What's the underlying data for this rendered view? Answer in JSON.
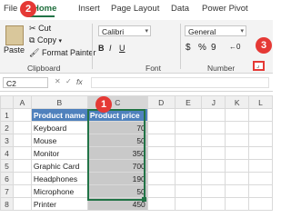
{
  "ribbon_tabs": [
    "File",
    "Home",
    "Insert",
    "Page Layout",
    "Data",
    "Power Pivot"
  ],
  "clipboard": {
    "paste": "Paste",
    "cut": "Cut",
    "copy": "Copy",
    "format_painter": "Format Painter",
    "label": "Clipboard"
  },
  "font": {
    "name": "Calibri",
    "label": "Font",
    "bold": "B",
    "italic": "I",
    "underline": "U"
  },
  "number": {
    "format": "General",
    "label": "Number",
    "currency": "$",
    "percent": "%",
    "comma": "9"
  },
  "callouts": [
    "1",
    "2",
    "3"
  ],
  "formula_bar": {
    "name_box": "C2",
    "fx": "fx"
  },
  "columns": [
    "A",
    "B",
    "C",
    "D",
    "E",
    "J",
    "K",
    "L"
  ],
  "table": {
    "headers": [
      "Product name",
      "Product price"
    ],
    "rows": [
      {
        "n": "2",
        "name": "Keyboard",
        "price": "70"
      },
      {
        "n": "3",
        "name": "Mouse",
        "price": "50"
      },
      {
        "n": "4",
        "name": "Monitor",
        "price": "350"
      },
      {
        "n": "5",
        "name": "Graphic Card",
        "price": "700"
      },
      {
        "n": "6",
        "name": "Headphones",
        "price": "190"
      },
      {
        "n": "7",
        "name": "Microphone",
        "price": "50"
      },
      {
        "n": "8",
        "name": "Printer",
        "price": "450"
      }
    ]
  },
  "colors": {
    "accent": "#217346",
    "callout": "#e53935",
    "header_fill": "#4f81bd"
  }
}
